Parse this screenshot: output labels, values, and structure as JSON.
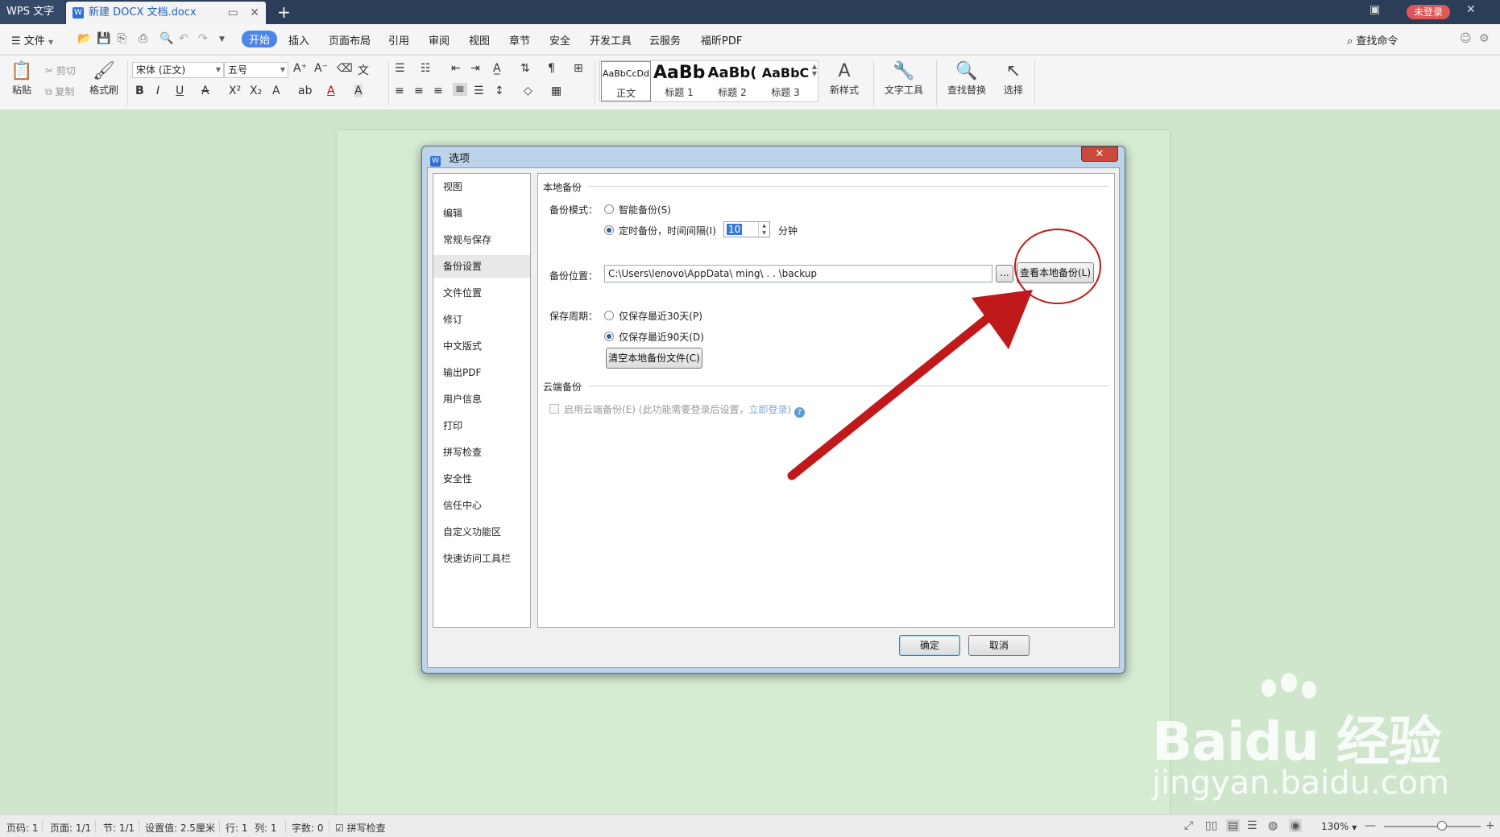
{
  "titlebar": {
    "app_name": "WPS 文字",
    "doc_tab": "新建 DOCX 文档.docx",
    "new_tab": "+",
    "login": "未登录"
  },
  "menubar": {
    "file": "文件",
    "items": [
      "开始",
      "插入",
      "页面布局",
      "引用",
      "审阅",
      "视图",
      "章节",
      "安全",
      "开发工具",
      "云服务",
      "福昕PDF"
    ],
    "active_index": 0,
    "search": "查找命令"
  },
  "ribbon": {
    "paste": "粘贴",
    "cut": "剪切",
    "copy": "复制",
    "format_painter": "格式刷",
    "font_name": "宋体 (正文)",
    "font_size": "五号",
    "styles": [
      {
        "sample": "AaBbCcDd",
        "name": "正文"
      },
      {
        "sample": "AaBb",
        "name": "标题 1"
      },
      {
        "sample": "AaBb(",
        "name": "标题 2"
      },
      {
        "sample": "AaBbC",
        "name": "标题 3"
      }
    ],
    "new_style": "新样式",
    "text_tool": "文字工具",
    "find_replace": "查找替换",
    "select": "选择"
  },
  "dialog": {
    "title": "选项",
    "close": "✕",
    "nav": [
      "视图",
      "编辑",
      "常规与保存",
      "备份设置",
      "文件位置",
      "修订",
      "中文版式",
      "输出PDF",
      "用户信息",
      "打印",
      "拼写检查",
      "安全性",
      "信任中心",
      "自定义功能区",
      "快速访问工具栏"
    ],
    "nav_selected": 3,
    "local_backup_title": "本地备份",
    "backup_mode_label": "备份模式：",
    "smart_backup": "智能备份(S)",
    "timed_backup": "定时备份，时间间隔(I)",
    "interval_value": "10",
    "interval_unit": "分钟",
    "location_label": "备份位置：",
    "location_path": "C:\\Users\\lenovo\\AppData\\        ming\\  .         .       \\backup",
    "browse": "...",
    "view_local_backup": "查看本地备份(L)",
    "retention_label": "保存周期：",
    "keep_30": "仅保存最近30天(P)",
    "keep_90": "仅保存最近90天(D)",
    "clear_local": "清空本地备份文件(C)",
    "cloud_backup_title": "云端备份",
    "enable_cloud": "启用云端备份(E) (此功能需要登录后设置，",
    "login_now": "立即登录",
    "enable_cloud_tail": ")",
    "help": "?",
    "ok": "确定",
    "cancel": "取消"
  },
  "statusbar": {
    "page_code": "页码: 1",
    "pages": "页面: 1/1",
    "section": "节: 1/1",
    "setting": "设置值: 2.5厘米",
    "row": "行: 1",
    "col": "列: 1",
    "words": "字数: 0",
    "spell": "拼写检查",
    "zoom": "130%"
  },
  "watermark": {
    "brand": "Bai",
    "brand_tail": "du",
    "brand_cn": "经验",
    "url": "jingyan.baidu.com"
  },
  "colors": {
    "background": "#cfe6cc",
    "titlebar": "#2c3e57",
    "accent": "#4d86e6",
    "annotation": "#c0191b",
    "login_badge": "#e05555"
  }
}
